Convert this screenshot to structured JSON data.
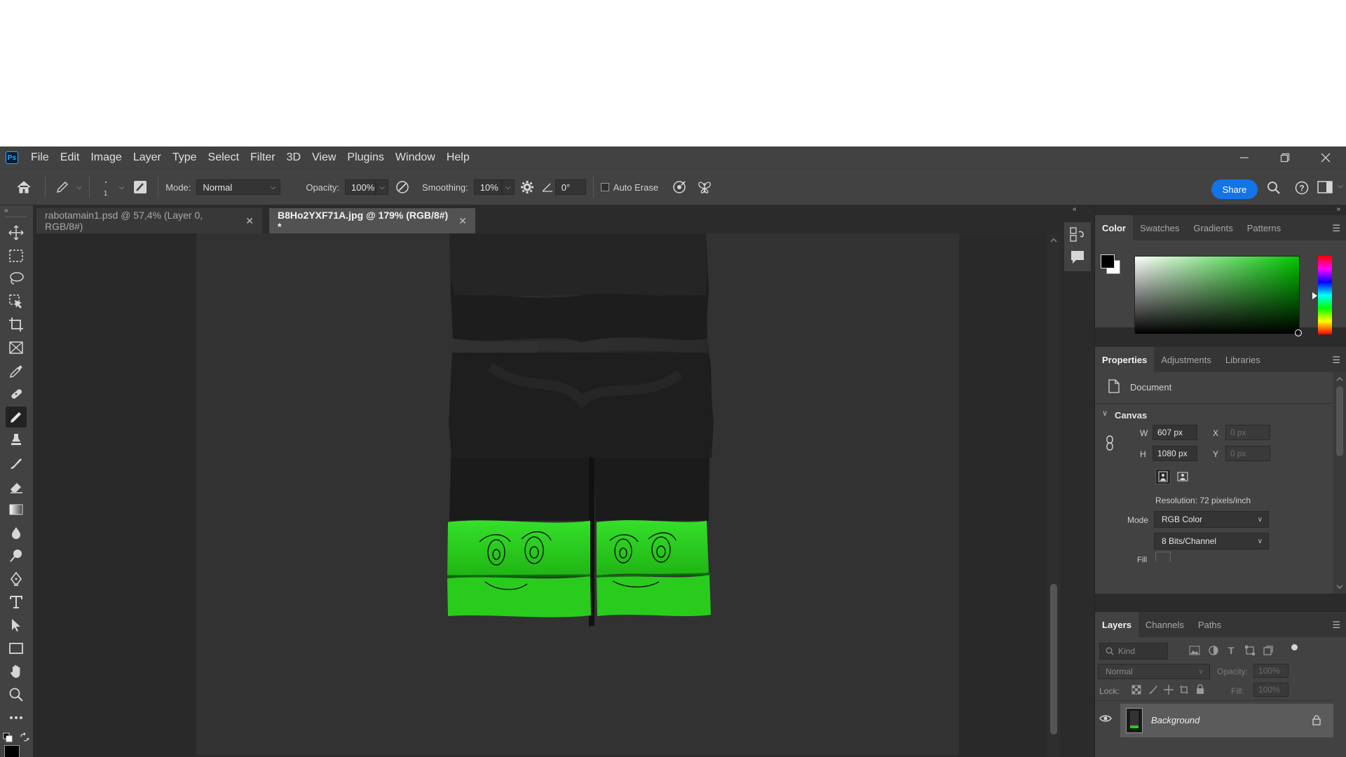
{
  "app": {
    "logo": "Ps",
    "menu": [
      "File",
      "Edit",
      "Image",
      "Layer",
      "Type",
      "Select",
      "Filter",
      "3D",
      "View",
      "Plugins",
      "Window",
      "Help"
    ]
  },
  "options_bar": {
    "brush_size": "1",
    "mode_label": "Mode:",
    "mode_value": "Normal",
    "opacity_label": "Opacity:",
    "opacity_value": "100%",
    "smoothing_label": "Smoothing:",
    "smoothing_value": "10%",
    "angle_value": "0°",
    "auto_erase_label": "Auto Erase",
    "share_label": "Share"
  },
  "tabs": [
    {
      "label": "rabotamain1.psd @ 57,4% (Layer 0, RGB/8#)",
      "active": false
    },
    {
      "label": "B8Ho2YXF71A.jpg @ 179% (RGB/8#) *",
      "active": true
    }
  ],
  "color_panel": {
    "tabs": [
      "Color",
      "Swatches",
      "Gradients",
      "Patterns"
    ],
    "foreground": "#000000",
    "background": "#ffffff",
    "hue_color": "#00c800"
  },
  "properties_panel": {
    "tabs": [
      "Properties",
      "Adjustments",
      "Libraries"
    ],
    "doc_label": "Document",
    "section_canvas": "Canvas",
    "w_label": "W",
    "w_value": "607 px",
    "h_label": "H",
    "h_value": "1080 px",
    "x_label": "X",
    "x_placeholder": "0 px",
    "y_label": "Y",
    "y_placeholder": "0 px",
    "resolution": "Resolution: 72 pixels/inch",
    "mode_label": "Mode",
    "mode_value": "RGB Color",
    "bits_value": "8 Bits/Channel",
    "fill_label": "Fill"
  },
  "layers_panel": {
    "tabs": [
      "Layers",
      "Channels",
      "Paths"
    ],
    "kind_placeholder": "Kind",
    "blend_mode": "Normal",
    "opacity_label": "Opacity:",
    "opacity_value": "100%",
    "lock_label": "Lock:",
    "fill_label": "Fill:",
    "fill_value": "100%",
    "layers": [
      {
        "name": "Background",
        "visible": true,
        "locked": true
      }
    ]
  }
}
